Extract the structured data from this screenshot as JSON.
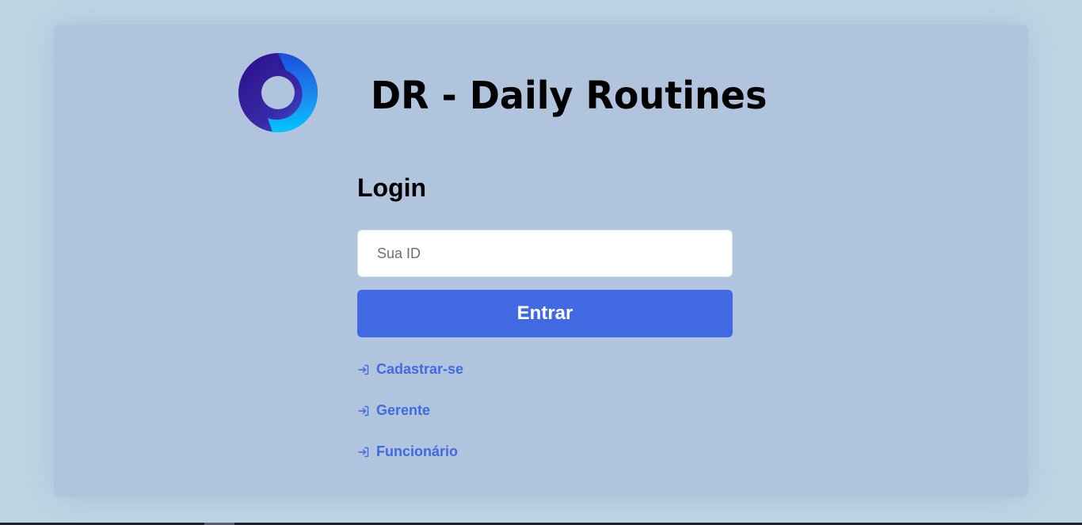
{
  "app": {
    "title": "DR - Daily Routines",
    "logo_icon": "ring-logo-icon"
  },
  "login": {
    "heading": "Login",
    "id_field": {
      "placeholder": "Sua ID",
      "value": ""
    },
    "submit_label": "Entrar"
  },
  "links": [
    {
      "label": "Cadastrar-se",
      "icon": "sign-in-arrow-icon"
    },
    {
      "label": "Gerente",
      "icon": "sign-in-arrow-icon"
    },
    {
      "label": "Funcionário",
      "icon": "sign-in-arrow-icon"
    }
  ],
  "colors": {
    "page_background": "#bed6e4",
    "card_background": "#b0c4de",
    "accent": "#4169e1",
    "logo_dark": "#2e1793",
    "logo_light": "#00c2ff"
  }
}
